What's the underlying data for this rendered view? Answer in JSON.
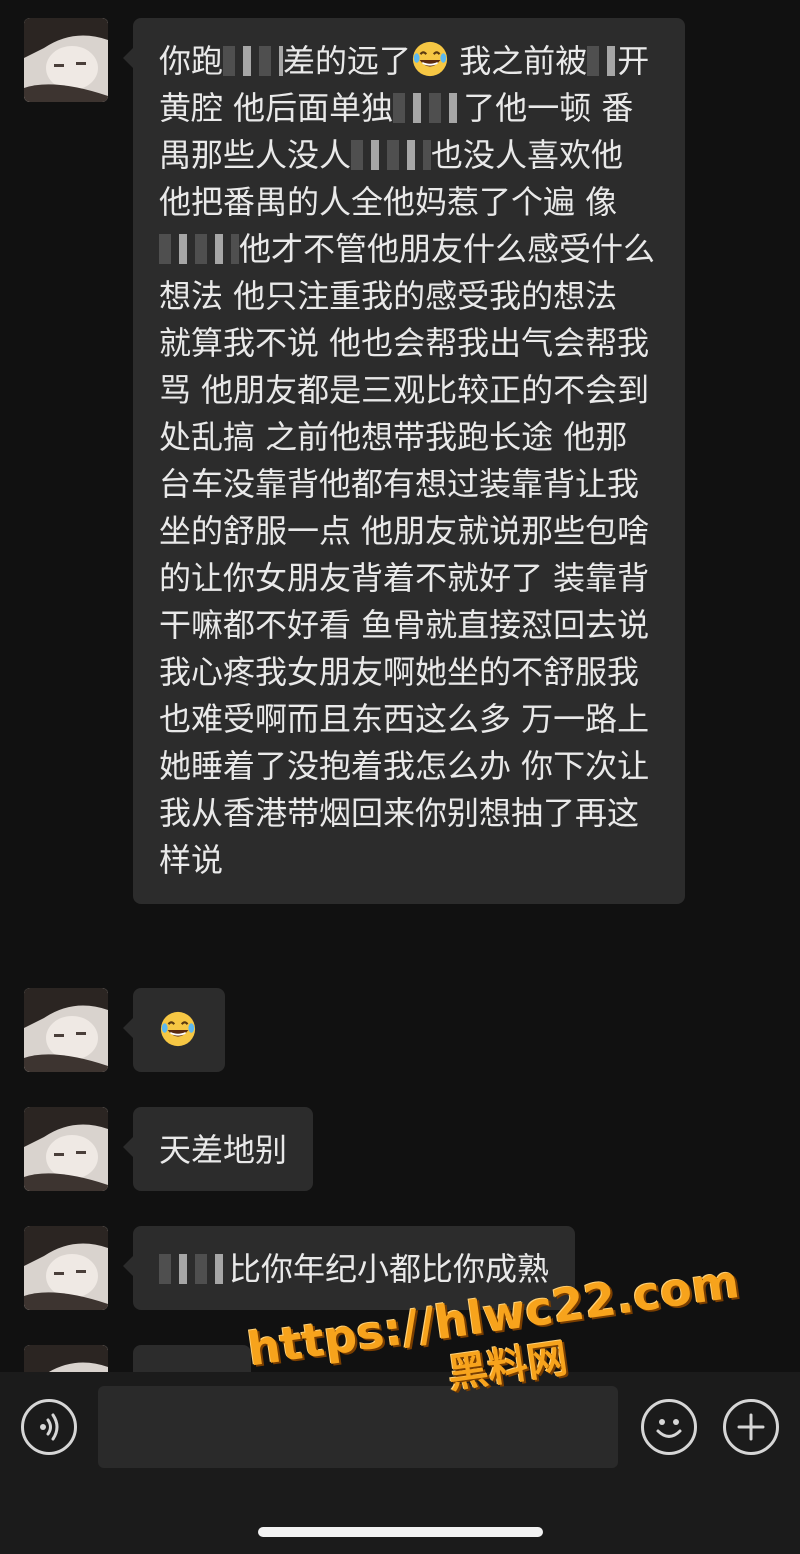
{
  "messages": [
    {
      "parts": [
        {
          "t": "你跑"
        },
        {
          "blur": 60
        },
        {
          "t": "差的远了"
        },
        {
          "emoji": "laughing-tears"
        },
        {
          "t": " 我之前被"
        },
        {
          "blur": 30
        },
        {
          "t": "开黄腔 他后面单独"
        },
        {
          "blur": 70
        },
        {
          "t": "了他一顿 番禺那些人没人"
        },
        {
          "blur": 80
        },
        {
          "t": "也没人喜欢他 他把番禺的人全他妈惹了个遍 像"
        },
        {
          "blur": 80
        },
        {
          "t": "他才不管他朋友什么感受什么想法 他只注重我的感受我的想法 就算我不说 他也会帮我出气会帮我骂 他朋友都是三观比较正的不会到处乱搞 之前他想带我跑长途 他那台车没靠背他都有想过装靠背让我坐的舒服一点 他朋友就说那些包啥的让你女朋友背着不就好了 装靠背干嘛都不好看 鱼骨就直接怼回去说我心疼我女朋友啊她坐的不舒服我也难受啊而且东西这么多 万一路上她睡着了没抱着我怎么办 你下次让我从香港带烟回来你别想抽了再这样说"
        }
      ]
    },
    {
      "parts": [
        {
          "emoji": "laughing-tears"
        }
      ]
    },
    {
      "parts": [
        {
          "t": "天差地别"
        }
      ]
    },
    {
      "parts": [
        {
          "blur": 70
        },
        {
          "t": "比你年纪小都比你成熟"
        }
      ]
    }
  ],
  "toolbar": {
    "voice_icon": "voice-icon",
    "emoji_icon": "smiley-icon",
    "plus_icon": "plus-icon"
  },
  "watermark": {
    "url": "https://hlwc22.com",
    "name": "黑料网"
  },
  "colors": {
    "background": "#111111",
    "bubble": "#2c2c2c",
    "text": "#e9e9e9",
    "watermark": "#f7a31c"
  }
}
